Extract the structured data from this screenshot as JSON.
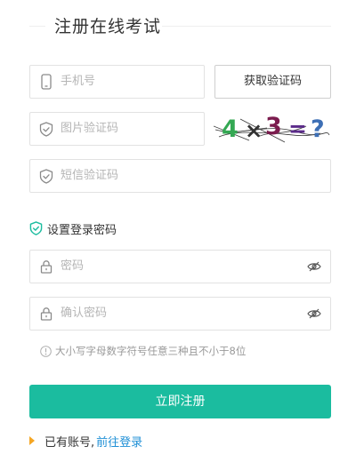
{
  "form": {
    "title": "注册在线考试",
    "phone": {
      "placeholder": "手机号"
    },
    "get_code_button": "获取验证码",
    "image_code": {
      "placeholder": "图片验证码"
    },
    "captcha": {
      "text": "4 × 3 = ?",
      "colors": {
        "four": "#34a853",
        "times": "#333333",
        "three": "#7b1c4e",
        "equals": "#5b2b8a",
        "question": "#3d6fb5"
      }
    },
    "sms_code": {
      "placeholder": "短信验证码"
    },
    "password_section_label": "设置登录密码",
    "password": {
      "placeholder": "密码"
    },
    "confirm_password": {
      "placeholder": "确认密码"
    },
    "password_hint": "大小写字母数字符号任意三种且不小于8位",
    "submit_button": "立即注册",
    "have_account_text": "已有账号,",
    "login_link": "前往登录"
  },
  "colors": {
    "accent": "#1bbc9f",
    "link": "#1e8fd6",
    "arrow": "#f5a623"
  },
  "icons": [
    "phone-icon",
    "shield-check-icon",
    "lock-icon",
    "eye-slash-icon",
    "info-icon",
    "arrow-right-icon"
  ]
}
